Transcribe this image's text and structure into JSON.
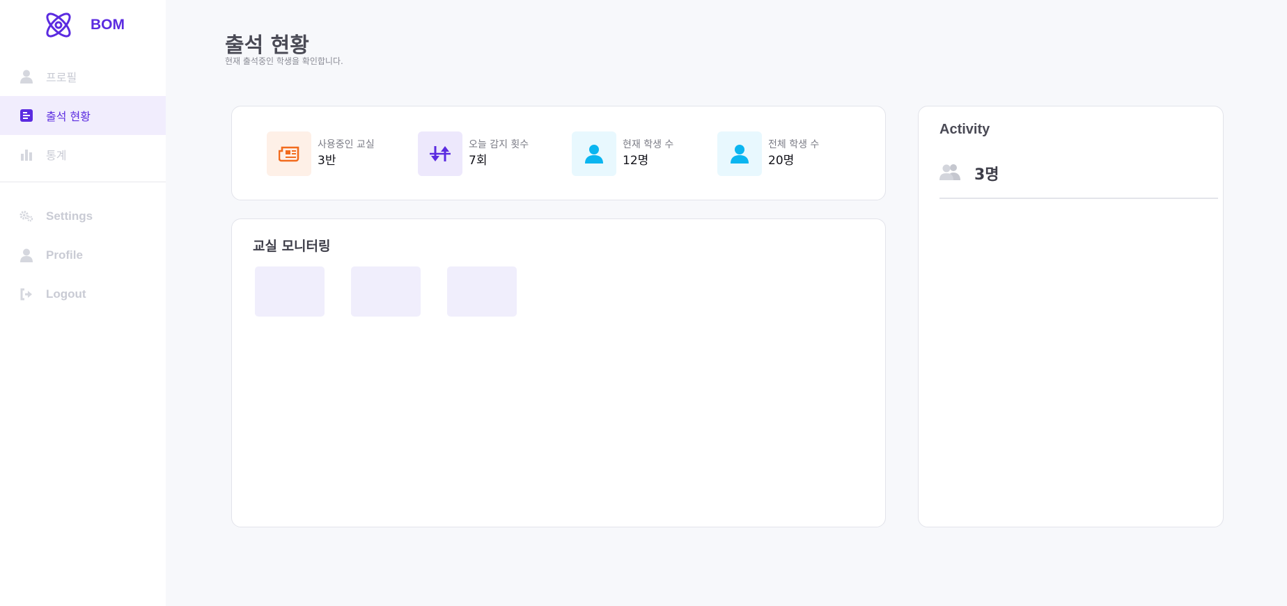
{
  "brand": {
    "name": "BOM",
    "icon": "atom-logo-icon"
  },
  "sidebar": {
    "items": [
      {
        "label": "프로필",
        "icon": "user-icon"
      },
      {
        "label": "출석 현황",
        "icon": "report-icon",
        "active": true
      },
      {
        "label": "통계",
        "icon": "bar-chart-icon"
      },
      {
        "label": "Settings",
        "icon": "gears-icon"
      },
      {
        "label": "Profile",
        "icon": "user-icon"
      },
      {
        "label": "Logout",
        "icon": "logout-icon"
      }
    ]
  },
  "header": {
    "title": "출석 현황",
    "subtitle": "현재 출석중인 학생을 확인합니다."
  },
  "stats": [
    {
      "label": "사용중인 교실",
      "value": "3반",
      "icon": "newspaper-icon",
      "color": "#f26b1d",
      "bg": "#fef0e7"
    },
    {
      "label": "오늘 감지 횟수",
      "value": "7회",
      "icon": "up-down-arrows-icon",
      "color": "#5b2be0",
      "bg": "#ede8fc"
    },
    {
      "label": "현재 학생 수",
      "value": "12명",
      "icon": "user-icon",
      "color": "#0bb5f0",
      "bg": "#e8f8fe"
    },
    {
      "label": "전체 학생 수",
      "value": "20명",
      "icon": "user-icon",
      "color": "#0bb5f0",
      "bg": "#e8f8fe"
    }
  ],
  "monitor": {
    "title": "교실 모니터링",
    "rooms": [
      "",
      "",
      ""
    ]
  },
  "activity": {
    "title": "Activity",
    "count": "3명",
    "icon": "users-icon"
  },
  "colors": {
    "accent": "#5b2be0",
    "muted": "#c9cbd4",
    "background": "#f7f8fb"
  }
}
